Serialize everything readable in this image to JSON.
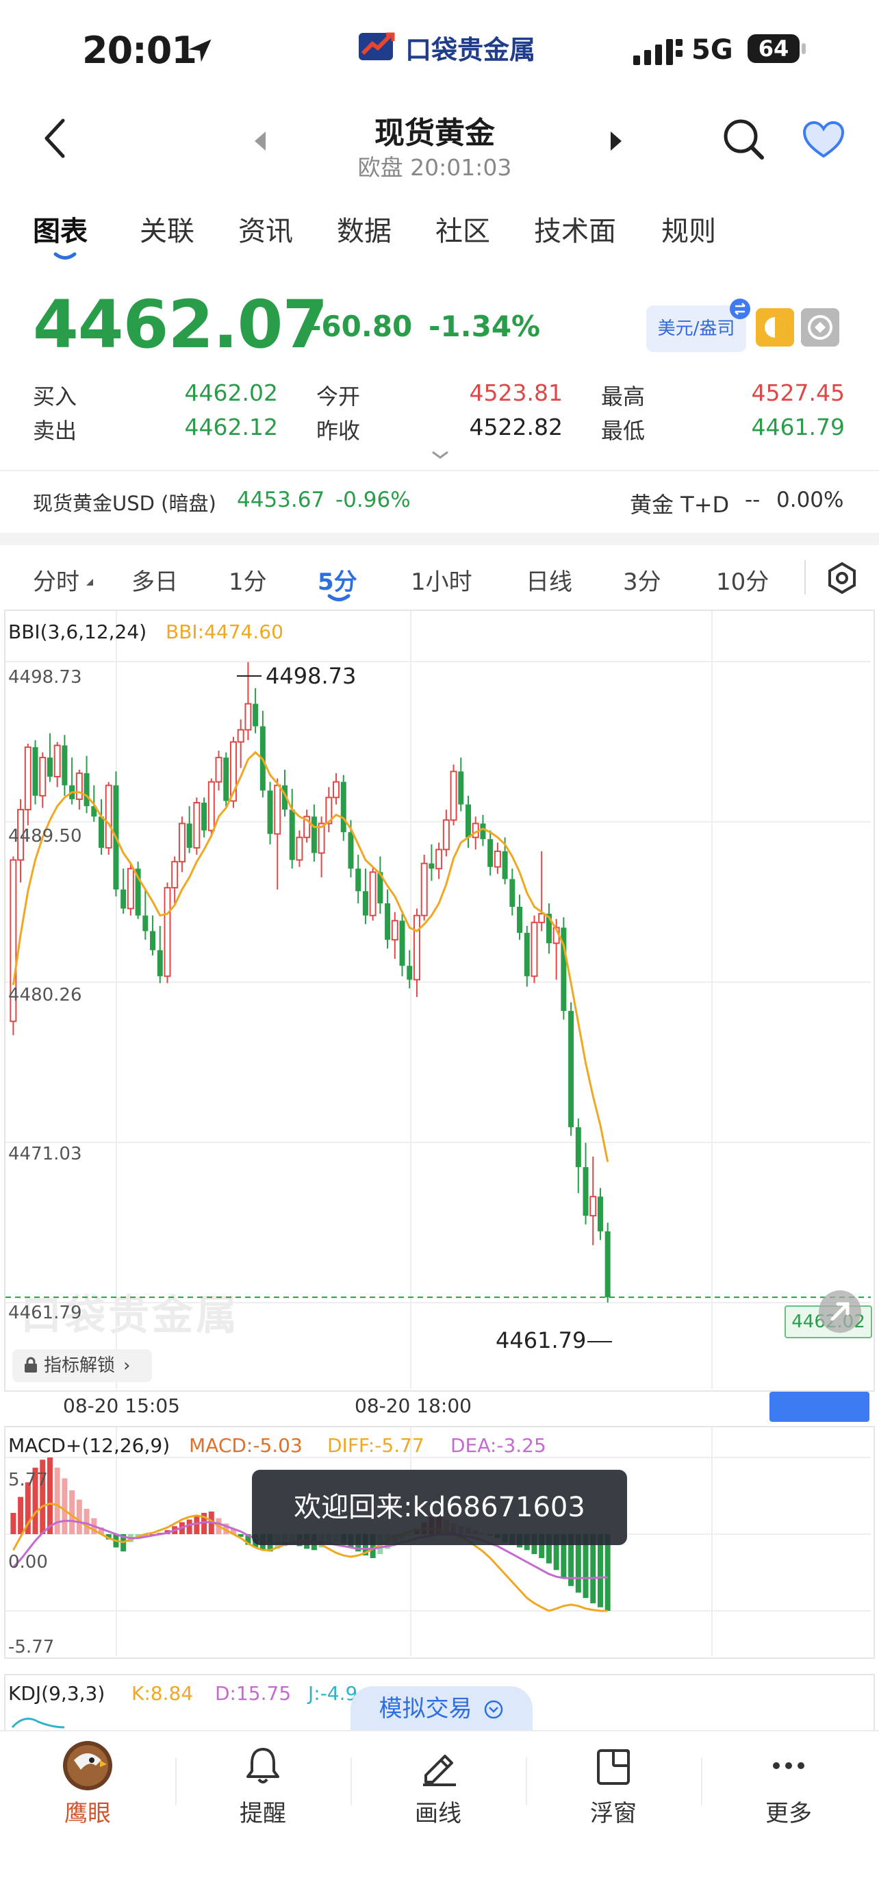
{
  "status_bar": {
    "time": "20:01",
    "network": "5G",
    "battery": "64"
  },
  "app": {
    "logo_text": "口袋贵金属"
  },
  "header": {
    "title": "现货黄金",
    "subtitle": "欧盘 20:01:03"
  },
  "tabs": [
    "图表",
    "关联",
    "资讯",
    "数据",
    "社区",
    "技术面",
    "规则"
  ],
  "quote": {
    "price": "4462.07",
    "change": "-60.80",
    "change_pct": "-1.34%",
    "currency_button": "美元/盎司",
    "bid_label": "买入",
    "bid": "4462.02",
    "ask_label": "卖出",
    "ask": "4462.12",
    "open_label": "今开",
    "open": "4523.81",
    "prev_close_label": "昨收",
    "prev_close": "4522.82",
    "high_label": "最高",
    "high": "4527.45",
    "low_label": "最低",
    "low": "4461.79"
  },
  "related": {
    "left_name": "现货黄金USD (暗盘)",
    "left_price": "4453.67",
    "left_pct": "-0.96%",
    "right_name": "黄金 T+D",
    "right_price": "--",
    "right_pct": "0.00%"
  },
  "periods": [
    "分时",
    "多日",
    "1分",
    "5分",
    "1小时",
    "日线",
    "3分",
    "10分"
  ],
  "main_chart": {
    "indicator_label": "BBI(3,6,12,24)",
    "bbi_value": "BBI:4474.60",
    "y_labels": [
      "4498.73",
      "4489.50",
      "4480.26",
      "4471.03",
      "4461.79"
    ],
    "high_marker": "4498.73",
    "low_marker": "4461.79",
    "price_tag": "4462.02",
    "watermark": "口袋贵金属",
    "unlock_label": "指标解锁",
    "time_labels": [
      "08-20 15:05",
      "08-20 18:00"
    ]
  },
  "macd": {
    "label": "MACD+(12,26,9)",
    "macd": "MACD:-5.03",
    "diff": "DIFF:-5.77",
    "dea": "DEA:-3.25",
    "y_labels": [
      "5.77",
      "0.00",
      "-5.77"
    ]
  },
  "kdj": {
    "label": "KDJ(9,3,3)",
    "k": "K:8.84",
    "d": "D:15.75",
    "j": "J:-4.9"
  },
  "toast": "欢迎回来:kd68671603",
  "sim_trade": "模拟交易",
  "bottom_nav": [
    "鹰眼",
    "提醒",
    "画线",
    "浮窗",
    "更多"
  ],
  "colors": {
    "up": "#e04848",
    "down": "#2a9d4a",
    "accent": "#2d6fe0",
    "bbi": "#f0a822"
  },
  "chart_data": {
    "type": "candlestick",
    "ylim": [
      4461.79,
      4498.73
    ],
    "y_ticks": [
      4498.73,
      4489.5,
      4480.26,
      4471.03,
      4461.79
    ],
    "x_labels": [
      "08-20 15:05",
      "08-20 18:00"
    ],
    "candles": [
      [
        4478.0,
        4487.5,
        4477.2,
        4487.3
      ],
      [
        4487.3,
        4490.8,
        4486.0,
        4490.2
      ],
      [
        4490.2,
        4494.0,
        4489.3,
        4493.8
      ],
      [
        4493.8,
        4494.2,
        4490.5,
        4491.0
      ],
      [
        4491.0,
        4493.5,
        4490.3,
        4493.2
      ],
      [
        4493.2,
        4494.6,
        4491.8,
        4492.1
      ],
      [
        4492.1,
        4494.1,
        4491.5,
        4493.9
      ],
      [
        4493.9,
        4494.5,
        4491.0,
        4491.6
      ],
      [
        4491.6,
        4493.2,
        4490.5,
        4490.8
      ],
      [
        4490.8,
        4492.5,
        4490.2,
        4492.3
      ],
      [
        4492.3,
        4493.3,
        4490.0,
        4490.4
      ],
      [
        4490.4,
        4491.6,
        4489.5,
        4489.8
      ],
      [
        4489.8,
        4490.8,
        4487.6,
        4488.0
      ],
      [
        4488.0,
        4491.8,
        4487.6,
        4491.6
      ],
      [
        4491.6,
        4492.4,
        4485.2,
        4485.6
      ],
      [
        4485.6,
        4486.8,
        4484.2,
        4484.5
      ],
      [
        4484.5,
        4487.1,
        4484.1,
        4486.8
      ],
      [
        4486.8,
        4487.2,
        4483.9,
        4484.1
      ],
      [
        4484.1,
        4485.6,
        4482.7,
        4483.2
      ],
      [
        4483.2,
        4484.1,
        4481.8,
        4482.1
      ],
      [
        4482.1,
        4483.5,
        4480.2,
        4480.6
      ],
      [
        4480.6,
        4486.0,
        4480.2,
        4485.7
      ],
      [
        4485.7,
        4487.5,
        4484.8,
        4487.2
      ],
      [
        4487.2,
        4489.8,
        4486.6,
        4489.4
      ],
      [
        4489.4,
        4490.4,
        4487.7,
        4488.0
      ],
      [
        4488.0,
        4490.9,
        4487.6,
        4490.6
      ],
      [
        4490.6,
        4490.9,
        4488.6,
        4489.0
      ],
      [
        4489.0,
        4492.0,
        4488.6,
        4491.8
      ],
      [
        4491.8,
        4493.6,
        4491.3,
        4493.2
      ],
      [
        4493.2,
        4493.5,
        4490.3,
        4490.7
      ],
      [
        4490.7,
        4494.4,
        4490.3,
        4494.1
      ],
      [
        4494.1,
        4495.4,
        4492.6,
        4494.8
      ],
      [
        4494.8,
        4498.7,
        4494.2,
        4496.3
      ],
      [
        4496.3,
        4497.2,
        4494.6,
        4495.0
      ],
      [
        4495.0,
        4495.9,
        4490.9,
        4491.3
      ],
      [
        4491.3,
        4491.8,
        4488.2,
        4488.8
      ],
      [
        4488.8,
        4492.0,
        4485.6,
        4491.6
      ],
      [
        4491.6,
        4492.5,
        4489.8,
        4490.2
      ],
      [
        4490.2,
        4491.4,
        4486.8,
        4487.3
      ],
      [
        4487.3,
        4489.0,
        4486.9,
        4488.6
      ],
      [
        4488.6,
        4490.2,
        4488.3,
        4489.8
      ],
      [
        4489.8,
        4490.5,
        4487.2,
        4487.7
      ],
      [
        4487.7,
        4489.8,
        4486.3,
        4489.4
      ],
      [
        4489.4,
        4491.5,
        4488.9,
        4490.9
      ],
      [
        4490.9,
        4492.3,
        4490.5,
        4491.8
      ],
      [
        4491.8,
        4492.2,
        4488.4,
        4488.9
      ],
      [
        4488.9,
        4489.6,
        4486.3,
        4486.8
      ],
      [
        4486.8,
        4487.6,
        4484.8,
        4485.5
      ],
      [
        4485.5,
        4486.8,
        4483.6,
        4484.1
      ],
      [
        4484.1,
        4486.9,
        4483.8,
        4486.6
      ],
      [
        4486.6,
        4487.5,
        4484.2,
        4484.8
      ],
      [
        4484.8,
        4485.6,
        4482.2,
        4482.7
      ],
      [
        4482.7,
        4484.3,
        4481.6,
        4483.8
      ],
      [
        4483.8,
        4484.2,
        4480.6,
        4481.2
      ],
      [
        4481.2,
        4482.1,
        4479.9,
        4480.4
      ],
      [
        4480.4,
        4484.5,
        4479.4,
        4484.1
      ],
      [
        4484.1,
        4487.6,
        4483.8,
        4487.1
      ],
      [
        4487.1,
        4488.2,
        4486.1,
        4486.8
      ],
      [
        4486.8,
        4488.3,
        4486.2,
        4487.9
      ],
      [
        4487.9,
        4490.2,
        4487.5,
        4489.6
      ],
      [
        4489.6,
        4492.8,
        4489.3,
        4492.4
      ],
      [
        4492.4,
        4493.2,
        4490.1,
        4490.5
      ],
      [
        4490.5,
        4491.0,
        4488.0,
        4488.6
      ],
      [
        4488.6,
        4489.8,
        4487.9,
        4489.4
      ],
      [
        4489.4,
        4489.9,
        4488.1,
        4488.5
      ],
      [
        4488.5,
        4489.0,
        4486.4,
        4486.9
      ],
      [
        4486.9,
        4488.3,
        4486.5,
        4487.8
      ],
      [
        4487.8,
        4488.6,
        4485.9,
        4486.2
      ],
      [
        4486.2,
        4486.8,
        4484.1,
        4484.6
      ],
      [
        4484.6,
        4485.3,
        4482.7,
        4483.1
      ],
      [
        4483.1,
        4483.5,
        4480.0,
        4480.6
      ],
      [
        4480.6,
        4484.1,
        4480.2,
        4483.7
      ],
      [
        4483.7,
        4487.8,
        4483.2,
        4484.2
      ],
      [
        4484.2,
        4484.8,
        4481.9,
        4482.5
      ],
      [
        4482.5,
        4483.9,
        4480.4,
        4483.4
      ],
      [
        4483.4,
        4484.0,
        4478.1,
        4478.6
      ],
      [
        4478.6,
        4479.1,
        4471.4,
        4471.9
      ],
      [
        4471.9,
        4472.4,
        4468.1,
        4469.6
      ],
      [
        4469.6,
        4471.0,
        4466.3,
        4466.8
      ],
      [
        4466.8,
        4470.2,
        4465.1,
        4467.9
      ],
      [
        4467.9,
        4468.4,
        4465.4,
        4465.9
      ],
      [
        4465.9,
        4466.4,
        4461.8,
        4462.1
      ]
    ],
    "bbi_line": [
      4480.1,
      4483.0,
      4485.5,
      4487.3,
      4488.6,
      4489.6,
      4490.4,
      4490.9,
      4491.2,
      4491.2,
      4491.0,
      4490.5,
      4489.8,
      4489.4,
      4488.6,
      4487.7,
      4487.1,
      4486.3,
      4485.6,
      4484.9,
      4484.1,
      4484.2,
      4484.7,
      4485.6,
      4486.3,
      4487.2,
      4487.9,
      4488.7,
      4489.8,
      4490.3,
      4491.2,
      4492.1,
      4493.1,
      4493.5,
      4493.1,
      4492.2,
      4491.7,
      4491.1,
      4490.2,
      4489.8,
      4489.6,
      4489.2,
      4489.2,
      4489.5,
      4489.9,
      4489.7,
      4489.1,
      4488.2,
      4487.3,
      4486.9,
      4486.5,
      4485.8,
      4485.2,
      4484.3,
      4483.4,
      4483.2,
      4483.6,
      4484.1,
      4484.8,
      4485.9,
      4487.4,
      4488.3,
      4488.6,
      4488.9,
      4489.1,
      4488.9,
      4488.6,
      4488.2,
      4487.5,
      4486.6,
      4485.4,
      4484.6,
      4484.3,
      4484.0,
      4483.3,
      4482.4,
      4480.2,
      4477.9,
      4475.6,
      4473.7,
      4472.0,
      4469.9
    ],
    "macd_hist": [
      1.6,
      2.8,
      3.9,
      5.0,
      5.6,
      5.77,
      5.0,
      4.2,
      3.3,
      2.6,
      1.9,
      1.2,
      0.5,
      -0.4,
      -1.0,
      -1.3,
      -0.6,
      -0.3,
      -0.2,
      0.0,
      0.1,
      0.3,
      0.6,
      0.9,
      1.1,
      1.4,
      1.6,
      1.7,
      1.2,
      0.8,
      0.4,
      -0.2,
      -0.8,
      -1.0,
      -1.2,
      -1.3,
      -1.1,
      -0.9,
      -0.7,
      -0.9,
      -1.1,
      -1.2,
      -1.0,
      -0.8,
      -0.6,
      -0.7,
      -1.0,
      -1.3,
      -1.6,
      -1.8,
      -1.5,
      -1.1,
      -0.7,
      -0.4,
      -0.1,
      0.4,
      0.9,
      1.3,
      1.4,
      1.1,
      0.8,
      0.6,
      0.5,
      0.3,
      0.1,
      -0.1,
      -0.3,
      -0.6,
      -0.8,
      -1.0,
      -1.2,
      -1.5,
      -1.8,
      -2.2,
      -2.7,
      -3.3,
      -3.9,
      -4.4,
      -4.8,
      -5.2,
      -5.5,
      -5.77
    ],
    "macd_diff": [
      -1.2,
      -0.2,
      0.8,
      1.6,
      2.1,
      2.3,
      2.2,
      1.8,
      1.4,
      1.0,
      0.6,
      0.3,
      0.0,
      -0.3,
      -0.5,
      -0.6,
      -0.4,
      -0.2,
      0.0,
      0.1,
      0.3,
      0.5,
      0.8,
      1.1,
      1.3,
      1.4,
      1.3,
      1.0,
      0.6,
      0.3,
      0.0,
      -0.3,
      -0.7,
      -1.0,
      -1.2,
      -1.2,
      -1.0,
      -0.8,
      -0.6,
      -0.5,
      -0.5,
      -0.6,
      -0.8,
      -1.1,
      -1.4,
      -1.6,
      -1.7,
      -1.6,
      -1.4,
      -1.1,
      -0.8,
      -0.5,
      -0.2,
      0.0,
      0.2,
      0.3,
      0.4,
      0.4,
      0.3,
      0.2,
      0.0,
      -0.2,
      -0.5,
      -0.9,
      -1.3,
      -1.8,
      -2.4,
      -3.0,
      -3.6,
      -4.2,
      -4.8,
      -5.2,
      -5.5,
      -5.77,
      -5.6,
      -5.4,
      -5.3,
      -5.4,
      -5.6,
      -5.7,
      -5.77,
      -5.77
    ],
    "macd_dea": [
      -2.5,
      -1.9,
      -1.2,
      -0.5,
      0.1,
      0.6,
      0.9,
      1.0,
      1.0,
      0.9,
      0.8,
      0.6,
      0.4,
      0.2,
      0.0,
      -0.2,
      -0.3,
      -0.3,
      -0.2,
      -0.1,
      0.0,
      0.1,
      0.3,
      0.5,
      0.7,
      0.8,
      0.9,
      0.9,
      0.8,
      0.6,
      0.4,
      0.2,
      -0.1,
      -0.3,
      -0.5,
      -0.7,
      -0.7,
      -0.7,
      -0.7,
      -0.6,
      -0.6,
      -0.6,
      -0.6,
      -0.7,
      -0.8,
      -0.9,
      -1.0,
      -1.1,
      -1.1,
      -1.1,
      -1.0,
      -0.9,
      -0.8,
      -0.6,
      -0.5,
      -0.3,
      -0.2,
      -0.1,
      0.0,
      0.0,
      0.0,
      -0.1,
      -0.2,
      -0.3,
      -0.5,
      -0.7,
      -0.9,
      -1.2,
      -1.5,
      -1.8,
      -2.1,
      -2.4,
      -2.7,
      -3.0,
      -3.2,
      -3.3,
      -3.3,
      -3.3,
      -3.3,
      -3.3,
      -3.25,
      -3.25
    ]
  }
}
